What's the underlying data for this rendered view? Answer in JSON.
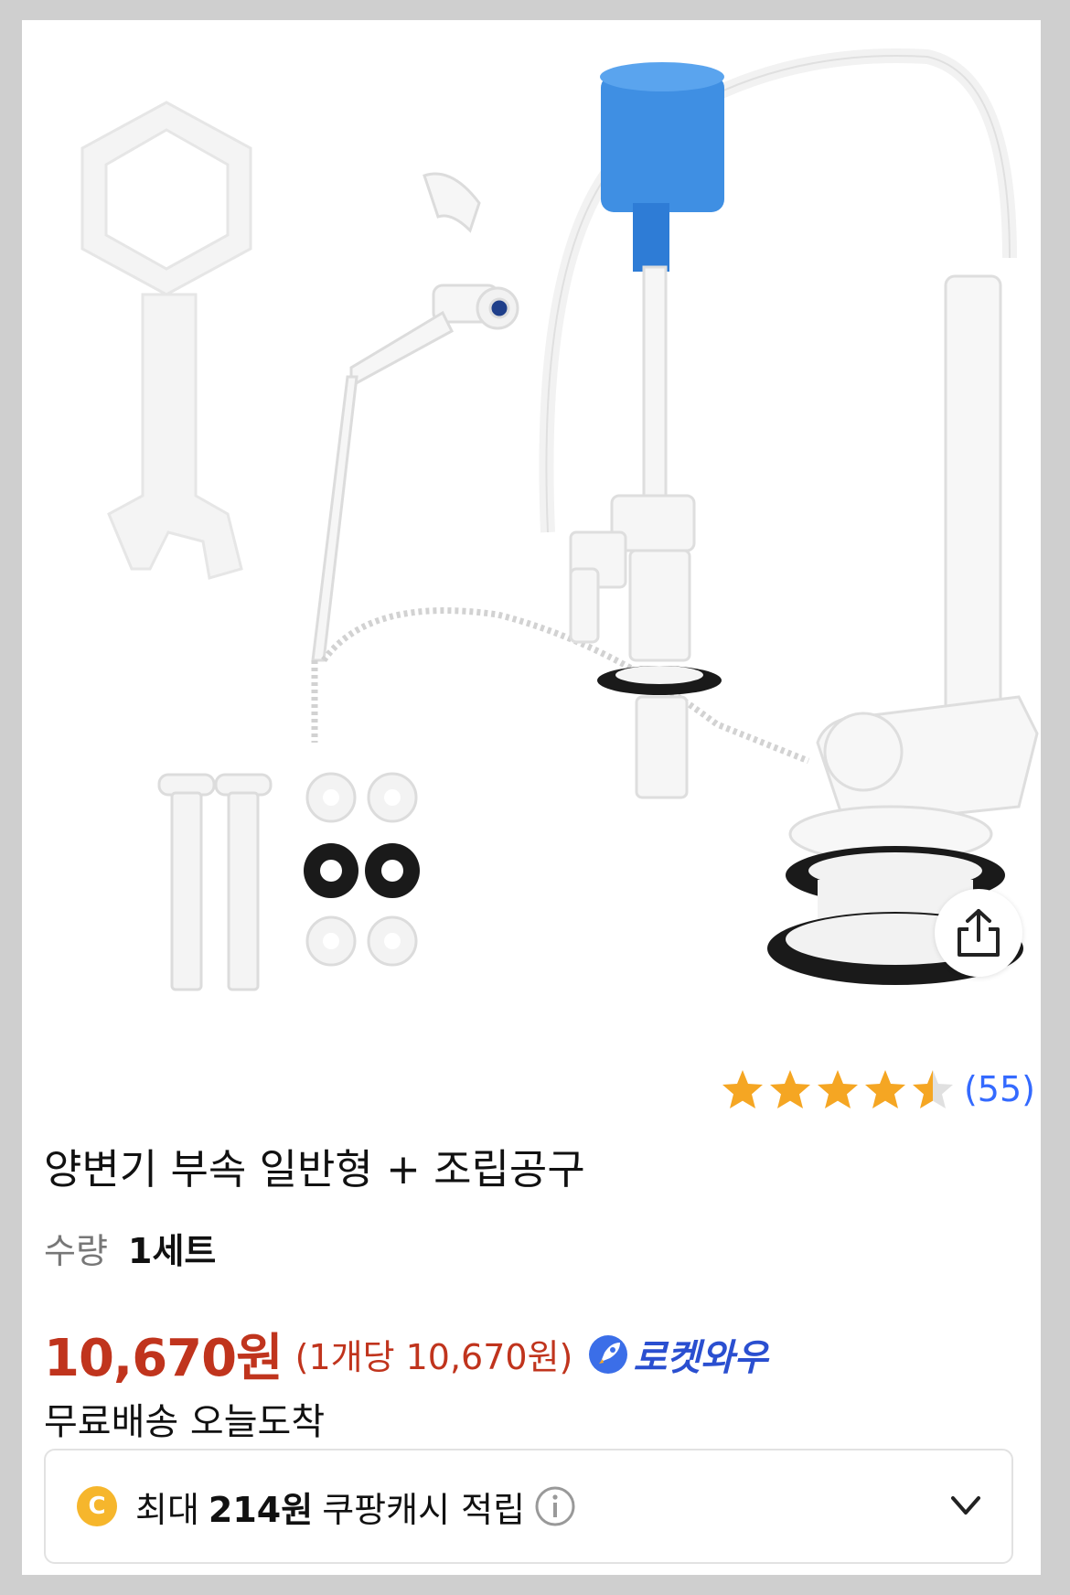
{
  "product": {
    "title": "양변기 부속 일반형 + 조립공구",
    "quantity_label": "수량",
    "quantity_value": "1세트",
    "price": "10,670원",
    "unit_price": "(1개당 10,670원)",
    "delivery_badge": "로켓와우",
    "shipping": "무료배송 오늘도착"
  },
  "rating": {
    "stars": 4.5,
    "max_stars": 5,
    "review_count": "(55)"
  },
  "cash": {
    "coin_label": "C",
    "prefix": "최대",
    "amount": "214원",
    "suffix": "쿠팡캐시 적립"
  },
  "icons": {
    "share": "share-icon",
    "info": "info-icon",
    "expand": "chevron-down-icon",
    "rocket": "rocket-icon"
  },
  "colors": {
    "price": "#c0341d",
    "link": "#346aff",
    "star": "#f5a623",
    "badge": "#2a4fd0",
    "coin": "#f6b62c"
  }
}
